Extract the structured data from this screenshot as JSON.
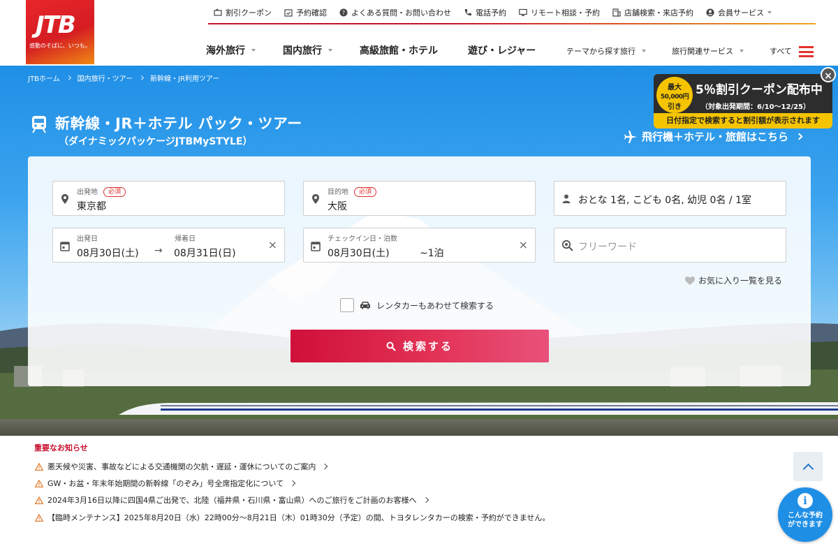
{
  "brand": {
    "logo_text": "JTB",
    "tagline": "感動のそばに、いつも。",
    "colors": {
      "primary": "#e2312e",
      "accent": "#f0a41c",
      "search_button": "#d0103a",
      "coupon_yellow": "#f5c400"
    }
  },
  "utility_nav": [
    {
      "label": "割引クーポン",
      "icon": "coupon-icon"
    },
    {
      "label": "予約確認",
      "icon": "calendar-check-icon"
    },
    {
      "label": "よくある質問・お問い合わせ",
      "icon": "question-icon"
    },
    {
      "label": "電話予約",
      "icon": "phone-icon"
    },
    {
      "label": "リモート相談・予約",
      "icon": "monitor-icon"
    },
    {
      "label": "店舗検索・来店予約",
      "icon": "store-icon"
    },
    {
      "label": "会員サービス",
      "icon": "user-icon"
    }
  ],
  "main_nav": [
    {
      "label": "海外旅行"
    },
    {
      "label": "国内旅行"
    },
    {
      "label": "高級旅館・ホテル"
    },
    {
      "label": "遊び・レジャー"
    },
    {
      "label": "テーマから探す旅行"
    },
    {
      "label": "旅行関連サービス"
    },
    {
      "label": "すべて"
    }
  ],
  "breadcrumb": [
    "JTBホーム",
    "国内旅行・ツアー",
    "新幹線・JR利用ツアー"
  ],
  "hero": {
    "title": "新幹線・JR＋ホテル パック・ツアー",
    "subtitle": "（ダイナミックパッケージJTBMySTYLE）",
    "flight_link": "飛行機＋ホテル・旅館はこちら"
  },
  "coupon": {
    "badge_line1": "最大",
    "badge_line2": "50,000円",
    "badge_line3": "引き",
    "headline": "5％割引クーポン配布中",
    "period": "（対象出発期間：6/10～12/25）",
    "note": "日付指定で検索すると割引額が表示されます",
    "close": "×"
  },
  "search": {
    "departure": {
      "label": "出発地",
      "required": "必須",
      "value": "東京都"
    },
    "destination": {
      "label": "目的地",
      "required": "必須",
      "value": "大阪"
    },
    "guests": {
      "value": "おとな 1名, こども 0名, 幼児 0名 / 1室"
    },
    "dates": {
      "out_label": "出発日",
      "out_value": "08月30日(土)",
      "return_label": "帰着日",
      "return_value": "08月31日(日)",
      "arrow": "→"
    },
    "checkin": {
      "label": "チェックイン日・泊数",
      "date_value": "08月30日(土)",
      "nights_value": "~1泊"
    },
    "freeword": {
      "placeholder": "フリーワード"
    },
    "clear_glyph": "×",
    "favorites_link": "お気に入り一覧を見る",
    "rental_car": "レンタカーもあわせて検索する",
    "button": "検索する"
  },
  "notices": {
    "title": "重要なお知らせ",
    "items": [
      "悪天候や災害、事故などによる交通機関の欠航・遅延・運休についてのご案内",
      "GW・お盆・年末年始期間の新幹線「のぞみ」号全席指定化について",
      "2024年3月16日以降に四国4県ご出発で、北陸（福井県・石川県・富山県）へのご旅行をご計画のお客様へ",
      "【臨時メンテナンス】2025年8月20日（水）22時00分～8月21日（木）01時30分（予定）の間、トヨタレンタカーの検索・予約ができません。"
    ]
  },
  "help": {
    "icon_glyph": "i",
    "line1": "こんな予約",
    "line2": "ができます"
  }
}
